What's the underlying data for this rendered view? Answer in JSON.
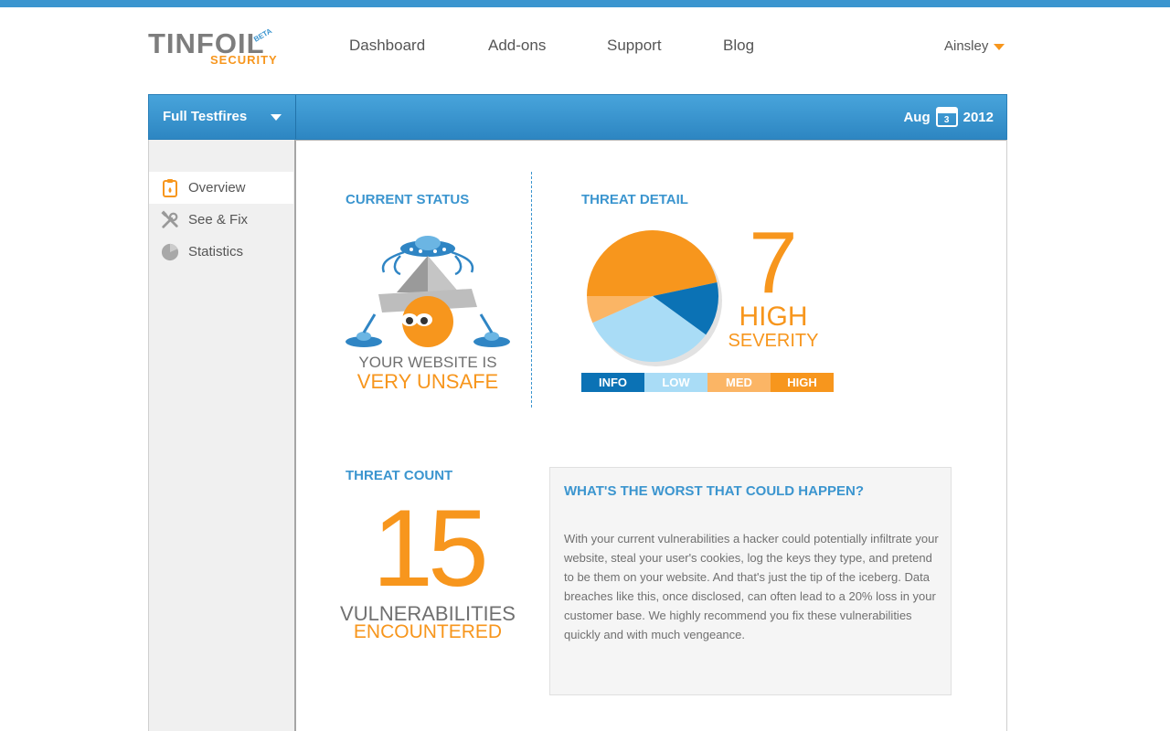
{
  "header": {
    "logo": {
      "word": "TINFOIL",
      "sub": "SECURITY",
      "badge": "BETA"
    },
    "nav": [
      "Dashboard",
      "Add-ons",
      "Support",
      "Blog"
    ],
    "user": "Ainsley"
  },
  "toolbar": {
    "scan_select": "Full Testfires",
    "month": "Aug",
    "calendar_day": "3",
    "year": "2012"
  },
  "sidebar": {
    "items": [
      {
        "label": "Overview",
        "icon": "clipboard-icon"
      },
      {
        "label": "See & Fix",
        "icon": "tools-icon"
      },
      {
        "label": "Statistics",
        "icon": "pie-chart-icon"
      }
    ]
  },
  "current_status": {
    "title": "CURRENT STATUS",
    "line1": "YOUR WEBSITE IS",
    "line2": "VERY UNSAFE"
  },
  "threat_detail": {
    "title": "THREAT DETAIL",
    "count": "7",
    "severity_line1": "HIGH",
    "severity_line2": "SEVERITY",
    "legend": [
      {
        "label": "INFO",
        "color": "#0b72b5"
      },
      {
        "label": "LOW",
        "color": "#a9dcf6"
      },
      {
        "label": "MED",
        "color": "#fbb565"
      },
      {
        "label": "HIGH",
        "color": "#f7961d"
      }
    ]
  },
  "chart_data": {
    "type": "pie",
    "categories": [
      "HIGH",
      "INFO",
      "LOW",
      "MED"
    ],
    "values": [
      7,
      2,
      5,
      1
    ],
    "colors": [
      "#f7961d",
      "#0b72b5",
      "#a9dcf6",
      "#fbb565"
    ]
  },
  "threat_count": {
    "title": "THREAT COUNT",
    "count": "15",
    "line1": "VULNERABILITIES",
    "line2": "ENCOUNTERED"
  },
  "worst_case": {
    "title": "WHAT'S THE WORST THAT COULD HAPPEN?",
    "body": "With your current vulnerabilities a hacker could potentially infiltrate your website, steal your user's cookies, log the keys they type, and pretend to be them on your website. And that's just the tip of the iceberg. Data breaches like this, once disclosed, can often lead to a 20% loss in your customer base. We highly recommend you fix these vulnerabilities quickly and with much vengeance."
  }
}
